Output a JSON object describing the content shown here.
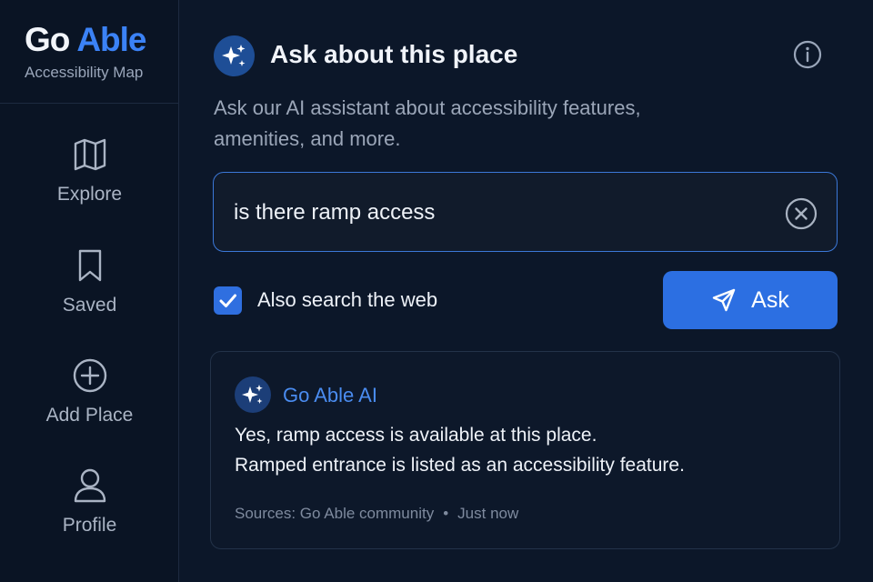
{
  "brand": {
    "name_part1": "Go",
    "name_part2": "Able",
    "subtitle": "Accessibility Map"
  },
  "nav": {
    "items": [
      {
        "label": "Explore",
        "icon": "map-icon"
      },
      {
        "label": "Saved",
        "icon": "bookmark-icon"
      },
      {
        "label": "Add Place",
        "icon": "plus-circle-icon"
      },
      {
        "label": "Profile",
        "icon": "user-icon"
      }
    ]
  },
  "header": {
    "title": "Ask about this place",
    "subtitle": "Ask our AI assistant about accessibility features, amenities, and more."
  },
  "query": {
    "value": "is there ramp access",
    "placeholder": ""
  },
  "options": {
    "web_search_label": "Also search the web",
    "web_search_checked": true
  },
  "ask_button": {
    "label": "Ask"
  },
  "answer": {
    "assistant_name": "Go Able AI",
    "line1": "Yes, ramp access is available at this place.",
    "line2": "Ramped entrance is listed as an accessibility feature.",
    "sources": "Sources: Go Able community",
    "time": "Just now"
  },
  "colors": {
    "accent": "#3b82f6",
    "button": "#2c6fe2",
    "background": "#0c1729"
  }
}
